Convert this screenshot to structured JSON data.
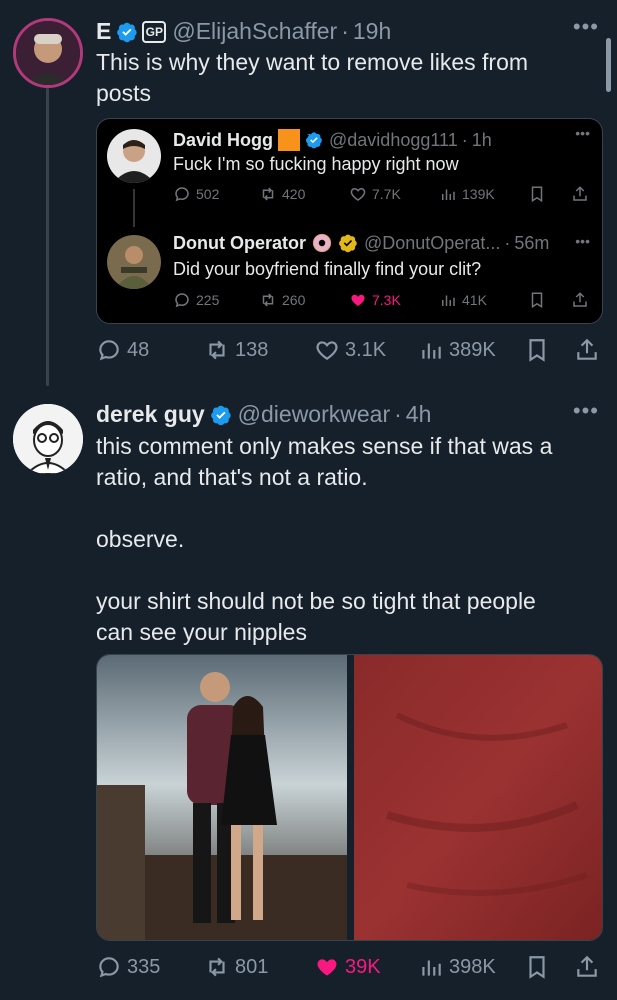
{
  "top_tweet": {
    "name": "E",
    "badge": "GP",
    "handle": "@ElijahSchaffer",
    "time": "19h",
    "text_line1": "This is why they want to remove likes from",
    "text_line2": "posts",
    "replies": "48",
    "retweets": "138",
    "likes": "3.1K",
    "views": "389K"
  },
  "quote": {
    "first": {
      "name": "David Hogg",
      "handle": "@davidhogg111",
      "time": "1h",
      "text": "Fuck I'm so fucking happy right now",
      "replies": "502",
      "retweets": "420",
      "likes": "7.7K",
      "views": "139K"
    },
    "second": {
      "name": "Donut Operator",
      "handle": "@DonutOperat...",
      "time": "56m",
      "text": "Did your boyfriend finally find your clit?",
      "replies": "225",
      "retweets": "260",
      "likes": "7.3K",
      "views": "41K"
    }
  },
  "reply_tweet": {
    "name": "derek guy",
    "handle": "@dieworkwear",
    "time": "4h",
    "text_line1": "this comment only makes sense if that was a",
    "text_line2": "ratio, and that's not a ratio.",
    "text_line3": "observe.",
    "text_line4": "your shirt should not be so tight that people",
    "text_line5": "can see your nipples",
    "replies": "335",
    "retweets": "801",
    "likes": "39K",
    "views": "398K"
  },
  "separator": "·",
  "colors": {
    "background": "#15202b",
    "verified_blue": "#1d9bf0",
    "like_pink": "#f91880",
    "muted": "#8b98a5"
  },
  "icons": [
    "reply-icon",
    "retweet-icon",
    "heart-icon",
    "views-icon",
    "bookmark-icon",
    "share-icon",
    "more-icon",
    "verified-icon"
  ]
}
